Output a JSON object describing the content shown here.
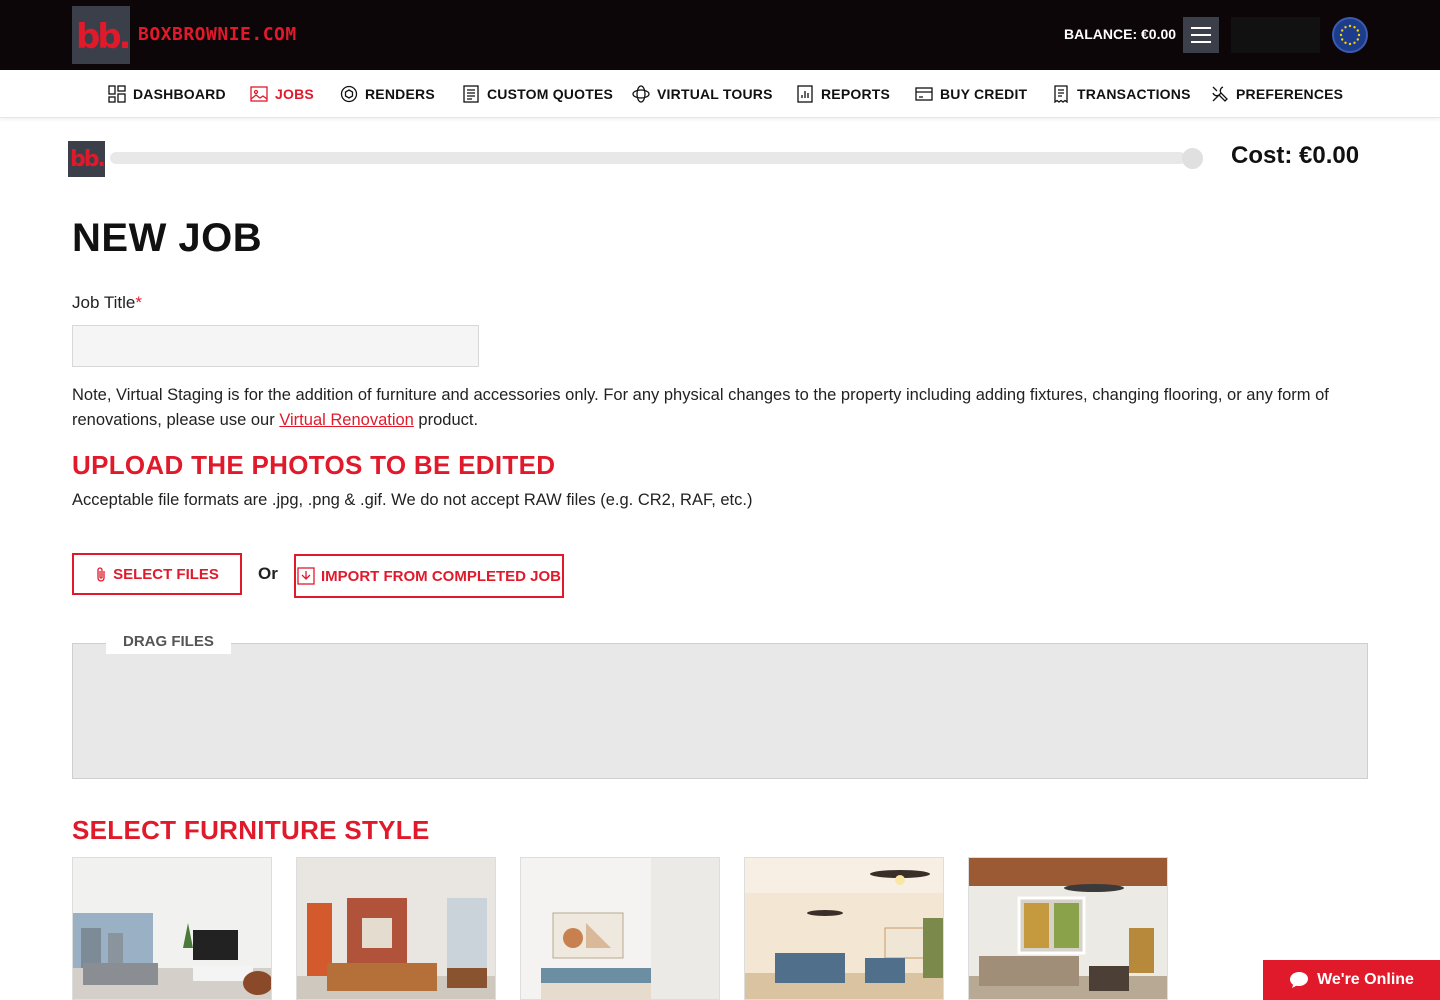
{
  "brand": {
    "logo_mark": "bb.",
    "site_name": "BOXBROWNIE.COM"
  },
  "header": {
    "balance": "BALANCE: €0.00"
  },
  "nav": {
    "items": [
      {
        "label": "DASHBOARD",
        "icon": "dashboard-icon"
      },
      {
        "label": "JOBS",
        "icon": "image-icon",
        "active": true
      },
      {
        "label": "RENDERS",
        "icon": "cube-icon"
      },
      {
        "label": "CUSTOM QUOTES",
        "icon": "document-icon"
      },
      {
        "label": "VIRTUAL TOURS",
        "icon": "tour-360-icon"
      },
      {
        "label": "REPORTS",
        "icon": "report-icon"
      },
      {
        "label": "BUY CREDIT",
        "icon": "credit-card-icon"
      },
      {
        "label": "TRANSACTIONS",
        "icon": "receipt-icon"
      },
      {
        "label": "PREFERENCES",
        "icon": "tools-icon"
      }
    ]
  },
  "progress": {
    "logo_mark": "bb.",
    "fraction": 0,
    "cost": "Cost: €0.00"
  },
  "page": {
    "title": "NEW JOB"
  },
  "form": {
    "job_title_label": "Job Title",
    "required_mark": "*",
    "job_title_value": "",
    "note_before": "Note, Virtual Staging is for the addition of furniture and accessories only. For any physical changes to the property including adding fixtures, changing flooring, or any form of renovations, please use our ",
    "note_link": "Virtual Renovation",
    "note_after": " product."
  },
  "upload": {
    "heading": "UPLOAD THE PHOTOS TO BE EDITED",
    "formats_text": "Acceptable file formats are .jpg, .png & .gif. We do not accept RAW files (e.g. CR2, RAF, etc.)",
    "select_files": "SELECT FILES",
    "or": "Or",
    "import_label": "IMPORT FROM COMPLETED JOB",
    "drag_label": "DRAG FILES"
  },
  "furniture": {
    "heading": "SELECT FURNITURE STYLE",
    "styles_count_visible": 5
  },
  "chat": {
    "label": "We're Online"
  },
  "colors": {
    "brand_red": "#e01a2b",
    "topbar": "#0c0608",
    "logo_bg": "#3a3f4a"
  }
}
